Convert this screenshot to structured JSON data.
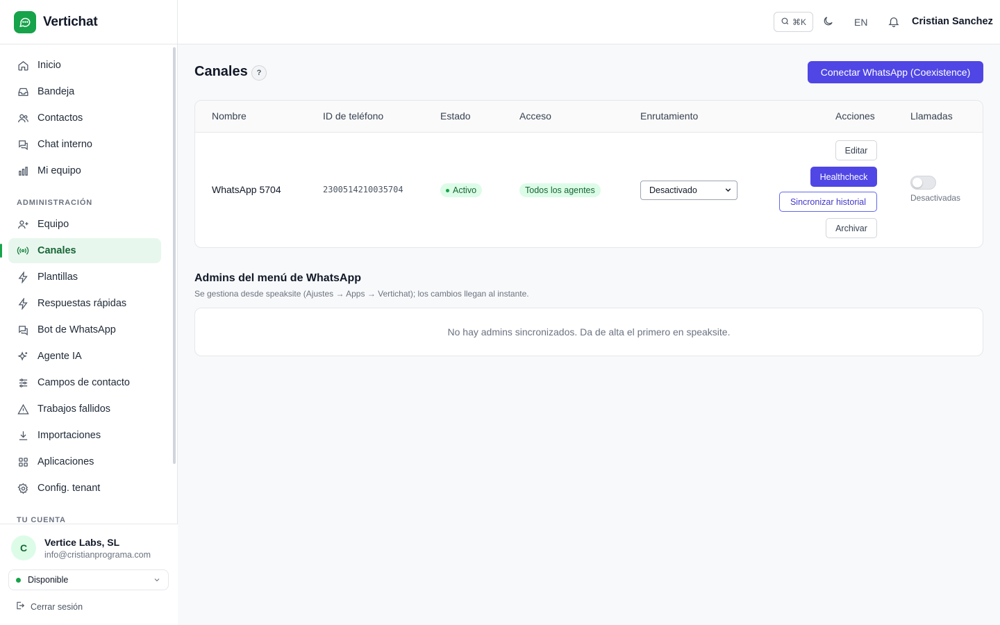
{
  "app": {
    "name": "Vertichat"
  },
  "topbar": {
    "search_shortcut": "⌘K",
    "language": "EN",
    "user_name": "Cristian Sanchez"
  },
  "sidebar": {
    "items": [
      {
        "label": "Inicio",
        "icon": "home-icon"
      },
      {
        "label": "Bandeja",
        "icon": "inbox-icon"
      },
      {
        "label": "Contactos",
        "icon": "users-icon"
      },
      {
        "label": "Chat interno",
        "icon": "chat-icon"
      },
      {
        "label": "Mi equipo",
        "icon": "bar-chart-icon"
      }
    ],
    "admin_label": "ADMINISTRACIÓN",
    "admin_items": [
      {
        "label": "Equipo",
        "icon": "user-plus-icon"
      },
      {
        "label": "Canales",
        "icon": "radio-icon",
        "active": true
      },
      {
        "label": "Plantillas",
        "icon": "bolt-icon"
      },
      {
        "label": "Respuestas rápidas",
        "icon": "bolt-icon"
      },
      {
        "label": "Bot de WhatsApp",
        "icon": "chat-icon"
      },
      {
        "label": "Agente IA",
        "icon": "sparkles-icon"
      },
      {
        "label": "Campos de contacto",
        "icon": "sliders-icon"
      },
      {
        "label": "Trabajos fallidos",
        "icon": "warning-icon"
      },
      {
        "label": "Importaciones",
        "icon": "download-icon"
      },
      {
        "label": "Aplicaciones",
        "icon": "grid-icon"
      },
      {
        "label": "Config. tenant",
        "icon": "gear-icon"
      }
    ],
    "account_label": "TU CUENTA",
    "account": {
      "avatar_initial": "C",
      "org_name": "Vertice Labs, SL",
      "email": "info@cristianprograma.com",
      "status": "Disponible",
      "logout": "Cerrar sesión"
    }
  },
  "main": {
    "title": "Canales",
    "help": "?",
    "connect_button": "Conectar WhatsApp (Coexistence)",
    "table": {
      "headers": [
        "Nombre",
        "ID de teléfono",
        "Estado",
        "Acceso",
        "Enrutamiento",
        "Acciones",
        "Llamadas"
      ],
      "rows": [
        {
          "name": "WhatsApp 5704",
          "phone_id": "2300514210035704",
          "status": "Activo",
          "access": "Todos los agentes",
          "routing": "Desactivado",
          "actions": {
            "edit": "Editar",
            "healthcheck": "Healthcheck",
            "sync": "Sincronizar historial",
            "archive": "Archivar"
          },
          "calls_enabled": false,
          "calls_label": "Desactivadas"
        }
      ]
    },
    "admins": {
      "title": "Admins del menú de WhatsApp",
      "subtitle": "Se gestiona desde speaksite (Ajustes → Apps → Vertichat); los cambios llegan al instante.",
      "empty": "No hay admins sincronizados. Da de alta el primero en speaksite."
    }
  },
  "colors": {
    "brand": "#16a34a",
    "primary": "#4f46e5",
    "active_bg": "#e8f7ee"
  }
}
